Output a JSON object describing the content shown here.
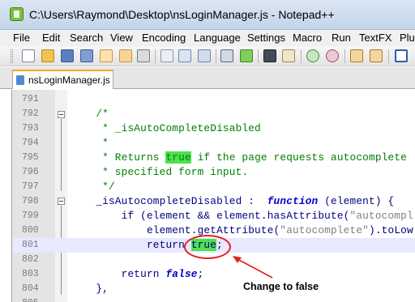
{
  "window": {
    "title": "C:\\Users\\Raymond\\Desktop\\nsLoginManager.js - Notepad++"
  },
  "menu": [
    "File",
    "Edit",
    "Search",
    "View",
    "Encoding",
    "Language",
    "Settings",
    "Macro",
    "Run",
    "TextFX",
    "Plug"
  ],
  "toolbar": {
    "icons": [
      "new-file-icon",
      "open-file-icon",
      "save-icon",
      "save-all-icon",
      "close-icon",
      "close-all-icon",
      "print-icon",
      "cut-icon",
      "copy-icon",
      "paste-icon",
      "undo-icon",
      "redo-icon",
      "find-icon",
      "replace-icon",
      "zoom-in-icon",
      "zoom-out-icon",
      "sync-vertical-icon",
      "sync-horizontal-icon",
      "word-wrap-icon"
    ]
  },
  "tab": {
    "label": "nsLoginManager.js"
  },
  "editor": {
    "lines": [
      {
        "num": "791",
        "text": ""
      },
      {
        "num": "792",
        "text": "    /*"
      },
      {
        "num": "793",
        "text": "     * _isAutoCompleteDisabled"
      },
      {
        "num": "794",
        "text": "     *"
      },
      {
        "num": "795",
        "before": "     * Returns ",
        "highlight": "true",
        "after": " if the page requests autocomplete"
      },
      {
        "num": "796",
        "text": "     * specified form input."
      },
      {
        "num": "797",
        "text": "     */"
      },
      {
        "num": "798",
        "before": "    _isAutocompleteDisabled :  ",
        "kw": "function",
        "after": " (element) {"
      },
      {
        "num": "799",
        "before": "        if (element && element.hasAttribute(",
        "str": "\"autocompl",
        "after": ""
      },
      {
        "num": "800",
        "before": "            element.getAttribute(",
        "str": "\"autocomplete\"",
        "after": ").toLow"
      },
      {
        "num": "801",
        "before": "            return ",
        "highlight": "true",
        "after": ";"
      },
      {
        "num": "802",
        "text": ""
      },
      {
        "num": "803",
        "before": "        return ",
        "kw": "false",
        "after": ";"
      },
      {
        "num": "804",
        "text": "    },"
      },
      {
        "num": "805",
        "text": ""
      }
    ]
  },
  "annotation": {
    "text": "Change to false",
    "color": "#e02020"
  },
  "colors": {
    "comment": "#008000",
    "keyword": "#0000c8",
    "string": "#808080",
    "highlight": "#4fe04f",
    "active_line": "#e8e8ff"
  }
}
